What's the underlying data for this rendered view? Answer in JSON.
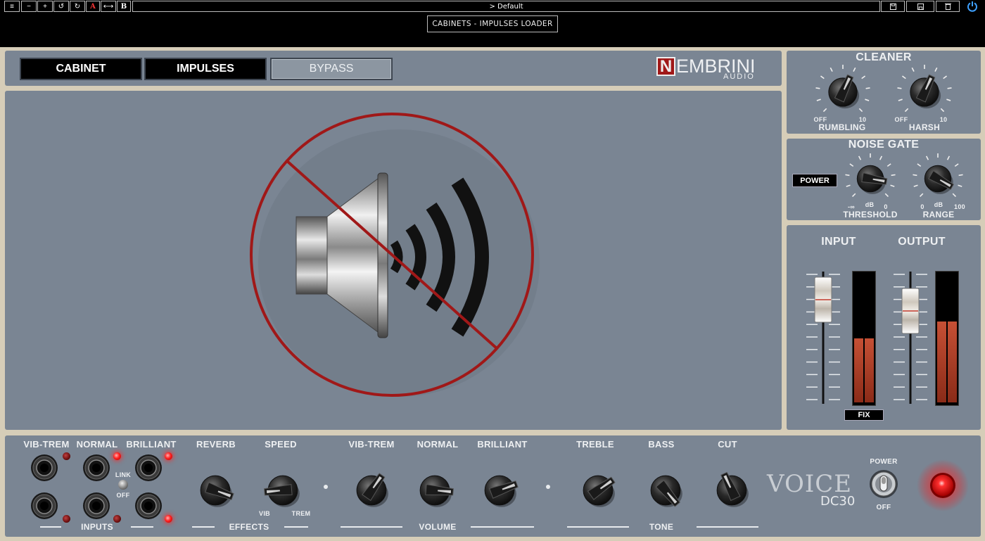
{
  "host": {
    "toolbar": [
      "≡",
      "−",
      "+",
      "↺",
      "↻",
      "A",
      "⟷",
      "B"
    ],
    "preset": "> Default",
    "right_icons": [
      "save-icon",
      "save-as-icon",
      "trash-icon",
      "power-icon"
    ],
    "plugin_title": "CABINETS - IMPULSES LOADER"
  },
  "tabs": {
    "cabinet": "CABINET",
    "impulses": "IMPULSES",
    "bypass": "BYPASS"
  },
  "brand": {
    "logo_letter": "N",
    "logo_rest": "EMBRINI",
    "logo_sub": "AUDIO"
  },
  "cleaner": {
    "title": "CLEANER",
    "rumbling": "RUMBLING",
    "harsh": "HARSH",
    "min": "OFF",
    "max": "10"
  },
  "noise_gate": {
    "title": "NOISE GATE",
    "power": "POWER",
    "threshold": "THRESHOLD",
    "range": "RANGE",
    "threshold_min": "-∞",
    "threshold_unit": "dB",
    "threshold_max": "0",
    "range_min": "0",
    "range_unit": "dB",
    "range_max": "100"
  },
  "levels": {
    "input": "INPUT",
    "output": "OUTPUT",
    "fix": "FIX",
    "input_meter": 0.52,
    "output_meter": 0.66
  },
  "amp": {
    "jacks": {
      "vib_trem": "VIB-TREM",
      "normal": "NORMAL",
      "brilliant": "BRILLIANT",
      "inputs": "INPUTS",
      "link": "LINK",
      "off": "OFF"
    },
    "effects": {
      "reverb": "REVERB",
      "speed": "SPEED",
      "vib": "VIB",
      "trem": "TREM",
      "group": "EFFECTS"
    },
    "volume": {
      "vib_trem": "VIB-TREM",
      "normal": "NORMAL",
      "brilliant": "BRILLIANT",
      "group": "VOLUME"
    },
    "tone": {
      "treble": "TREBLE",
      "bass": "BASS",
      "cut": "CUT",
      "group": "TONE"
    },
    "voice": "VOICE",
    "model": "DC30",
    "power": "POWER",
    "power_off": "OFF"
  },
  "colors": {
    "panel": "#7a8593",
    "frame": "#d6cdb8",
    "accent_red": "#a01818"
  }
}
